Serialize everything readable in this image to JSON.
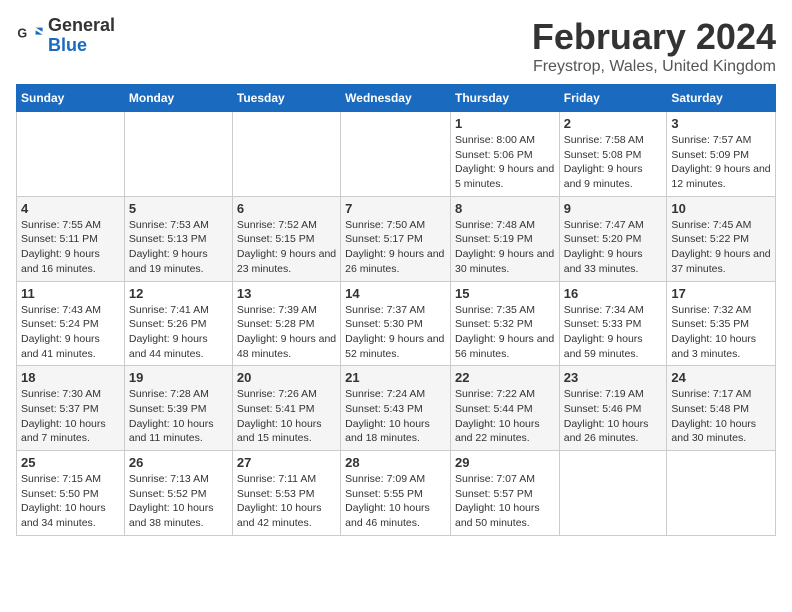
{
  "logo": {
    "line1": "General",
    "line2": "Blue"
  },
  "title": "February 2024",
  "subtitle": "Freystrop, Wales, United Kingdom",
  "days_of_week": [
    "Sunday",
    "Monday",
    "Tuesday",
    "Wednesday",
    "Thursday",
    "Friday",
    "Saturday"
  ],
  "weeks": [
    [
      {
        "day": "",
        "sunrise": "",
        "sunset": "",
        "daylight": ""
      },
      {
        "day": "",
        "sunrise": "",
        "sunset": "",
        "daylight": ""
      },
      {
        "day": "",
        "sunrise": "",
        "sunset": "",
        "daylight": ""
      },
      {
        "day": "",
        "sunrise": "",
        "sunset": "",
        "daylight": ""
      },
      {
        "day": "1",
        "sunrise": "Sunrise: 8:00 AM",
        "sunset": "Sunset: 5:06 PM",
        "daylight": "Daylight: 9 hours and 5 minutes."
      },
      {
        "day": "2",
        "sunrise": "Sunrise: 7:58 AM",
        "sunset": "Sunset: 5:08 PM",
        "daylight": "Daylight: 9 hours and 9 minutes."
      },
      {
        "day": "3",
        "sunrise": "Sunrise: 7:57 AM",
        "sunset": "Sunset: 5:09 PM",
        "daylight": "Daylight: 9 hours and 12 minutes."
      }
    ],
    [
      {
        "day": "4",
        "sunrise": "Sunrise: 7:55 AM",
        "sunset": "Sunset: 5:11 PM",
        "daylight": "Daylight: 9 hours and 16 minutes."
      },
      {
        "day": "5",
        "sunrise": "Sunrise: 7:53 AM",
        "sunset": "Sunset: 5:13 PM",
        "daylight": "Daylight: 9 hours and 19 minutes."
      },
      {
        "day": "6",
        "sunrise": "Sunrise: 7:52 AM",
        "sunset": "Sunset: 5:15 PM",
        "daylight": "Daylight: 9 hours and 23 minutes."
      },
      {
        "day": "7",
        "sunrise": "Sunrise: 7:50 AM",
        "sunset": "Sunset: 5:17 PM",
        "daylight": "Daylight: 9 hours and 26 minutes."
      },
      {
        "day": "8",
        "sunrise": "Sunrise: 7:48 AM",
        "sunset": "Sunset: 5:19 PM",
        "daylight": "Daylight: 9 hours and 30 minutes."
      },
      {
        "day": "9",
        "sunrise": "Sunrise: 7:47 AM",
        "sunset": "Sunset: 5:20 PM",
        "daylight": "Daylight: 9 hours and 33 minutes."
      },
      {
        "day": "10",
        "sunrise": "Sunrise: 7:45 AM",
        "sunset": "Sunset: 5:22 PM",
        "daylight": "Daylight: 9 hours and 37 minutes."
      }
    ],
    [
      {
        "day": "11",
        "sunrise": "Sunrise: 7:43 AM",
        "sunset": "Sunset: 5:24 PM",
        "daylight": "Daylight: 9 hours and 41 minutes."
      },
      {
        "day": "12",
        "sunrise": "Sunrise: 7:41 AM",
        "sunset": "Sunset: 5:26 PM",
        "daylight": "Daylight: 9 hours and 44 minutes."
      },
      {
        "day": "13",
        "sunrise": "Sunrise: 7:39 AM",
        "sunset": "Sunset: 5:28 PM",
        "daylight": "Daylight: 9 hours and 48 minutes."
      },
      {
        "day": "14",
        "sunrise": "Sunrise: 7:37 AM",
        "sunset": "Sunset: 5:30 PM",
        "daylight": "Daylight: 9 hours and 52 minutes."
      },
      {
        "day": "15",
        "sunrise": "Sunrise: 7:35 AM",
        "sunset": "Sunset: 5:32 PM",
        "daylight": "Daylight: 9 hours and 56 minutes."
      },
      {
        "day": "16",
        "sunrise": "Sunrise: 7:34 AM",
        "sunset": "Sunset: 5:33 PM",
        "daylight": "Daylight: 9 hours and 59 minutes."
      },
      {
        "day": "17",
        "sunrise": "Sunrise: 7:32 AM",
        "sunset": "Sunset: 5:35 PM",
        "daylight": "Daylight: 10 hours and 3 minutes."
      }
    ],
    [
      {
        "day": "18",
        "sunrise": "Sunrise: 7:30 AM",
        "sunset": "Sunset: 5:37 PM",
        "daylight": "Daylight: 10 hours and 7 minutes."
      },
      {
        "day": "19",
        "sunrise": "Sunrise: 7:28 AM",
        "sunset": "Sunset: 5:39 PM",
        "daylight": "Daylight: 10 hours and 11 minutes."
      },
      {
        "day": "20",
        "sunrise": "Sunrise: 7:26 AM",
        "sunset": "Sunset: 5:41 PM",
        "daylight": "Daylight: 10 hours and 15 minutes."
      },
      {
        "day": "21",
        "sunrise": "Sunrise: 7:24 AM",
        "sunset": "Sunset: 5:43 PM",
        "daylight": "Daylight: 10 hours and 18 minutes."
      },
      {
        "day": "22",
        "sunrise": "Sunrise: 7:22 AM",
        "sunset": "Sunset: 5:44 PM",
        "daylight": "Daylight: 10 hours and 22 minutes."
      },
      {
        "day": "23",
        "sunrise": "Sunrise: 7:19 AM",
        "sunset": "Sunset: 5:46 PM",
        "daylight": "Daylight: 10 hours and 26 minutes."
      },
      {
        "day": "24",
        "sunrise": "Sunrise: 7:17 AM",
        "sunset": "Sunset: 5:48 PM",
        "daylight": "Daylight: 10 hours and 30 minutes."
      }
    ],
    [
      {
        "day": "25",
        "sunrise": "Sunrise: 7:15 AM",
        "sunset": "Sunset: 5:50 PM",
        "daylight": "Daylight: 10 hours and 34 minutes."
      },
      {
        "day": "26",
        "sunrise": "Sunrise: 7:13 AM",
        "sunset": "Sunset: 5:52 PM",
        "daylight": "Daylight: 10 hours and 38 minutes."
      },
      {
        "day": "27",
        "sunrise": "Sunrise: 7:11 AM",
        "sunset": "Sunset: 5:53 PM",
        "daylight": "Daylight: 10 hours and 42 minutes."
      },
      {
        "day": "28",
        "sunrise": "Sunrise: 7:09 AM",
        "sunset": "Sunset: 5:55 PM",
        "daylight": "Daylight: 10 hours and 46 minutes."
      },
      {
        "day": "29",
        "sunrise": "Sunrise: 7:07 AM",
        "sunset": "Sunset: 5:57 PM",
        "daylight": "Daylight: 10 hours and 50 minutes."
      },
      {
        "day": "",
        "sunrise": "",
        "sunset": "",
        "daylight": ""
      },
      {
        "day": "",
        "sunrise": "",
        "sunset": "",
        "daylight": ""
      }
    ]
  ]
}
